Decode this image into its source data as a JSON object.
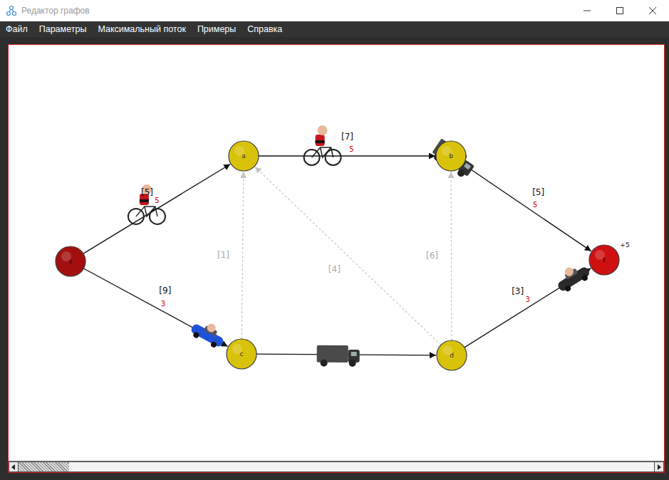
{
  "window": {
    "title": "Редактор графов"
  },
  "menu": [
    {
      "label": "Файл"
    },
    {
      "label": "Параметры"
    },
    {
      "label": "Максимальный поток"
    },
    {
      "label": "Примеры"
    },
    {
      "label": "Справка"
    }
  ],
  "graph": {
    "nodes": [
      {
        "label": "s",
        "kind": "source",
        "color": "#a30f0f"
      },
      {
        "label": "a",
        "kind": "inner",
        "color": "#d8c30a"
      },
      {
        "label": "b",
        "kind": "inner",
        "color": "#d8c30a"
      },
      {
        "label": "c",
        "kind": "inner",
        "color": "#d8c30a"
      },
      {
        "label": "d",
        "kind": "inner",
        "color": "#d8c30a"
      },
      {
        "label": "t",
        "kind": "sink",
        "color": "#cf1010",
        "badge": "+5"
      }
    ],
    "edges": [
      {
        "from": "s",
        "to": "a",
        "capacity": "[5]",
        "flow": "5",
        "dashed": false,
        "vehicle": "bike",
        "vehicle_color": "#c8161d",
        "level": 0.44
      },
      {
        "from": "a",
        "to": "b",
        "capacity": "[7]",
        "flow": "5",
        "dashed": false,
        "vehicle": "bike",
        "vehicle_color": "#c8161d",
        "level": 0.38
      },
      {
        "from": "b",
        "to": "t",
        "capacity": "[5]",
        "flow": "5",
        "dashed": false,
        "vehicle": "truck",
        "vehicle_color": "#4a4a4a",
        "level": 0.02
      },
      {
        "from": "s",
        "to": "c",
        "capacity": "[9]",
        "flow": "3",
        "dashed": false,
        "vehicle": "car",
        "vehicle_color": "#1f52d6",
        "level": 0.8
      },
      {
        "from": "c",
        "to": "d",
        "dashed": false,
        "vehicle": "truck",
        "vehicle_color": "#4a4a4a",
        "level": 0.46
      },
      {
        "from": "d",
        "to": "t",
        "capacity": "[3]",
        "flow": "3",
        "dashed": false,
        "vehicle": "car",
        "vehicle_color": "#2a2a2a",
        "level": 0.8
      },
      {
        "from": "c",
        "to": "a",
        "capacity": "[1]",
        "dashed": true
      },
      {
        "from": "d",
        "to": "a",
        "capacity": "[4]",
        "dashed": true
      },
      {
        "from": "d",
        "to": "b",
        "capacity": "[6]",
        "dashed": true
      }
    ]
  },
  "scrollbar": {
    "level": 0.08
  }
}
